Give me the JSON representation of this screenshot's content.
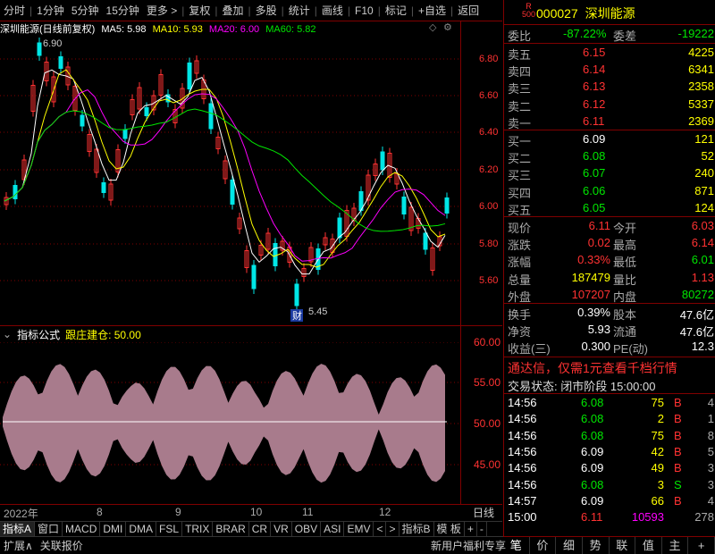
{
  "toolbar": {
    "items": [
      "分时",
      "1分钟",
      "5分钟",
      "15分钟",
      "更多 >",
      "复权",
      "叠加",
      "多股",
      "统计",
      "画线",
      "F10",
      "标记",
      "+自选",
      "返回"
    ]
  },
  "chart_head": {
    "title": "深圳能源(日线前复权)",
    "ma5": "MA5: 5.98",
    "ma10": "MA10: 5.93",
    "ma20": "MA20: 6.00",
    "ma60": "MA60: 5.82"
  },
  "price_axis": [
    "6.80",
    "6.60",
    "6.40",
    "6.20",
    "6.00",
    "5.80",
    "5.60"
  ],
  "annotations": {
    "high": "6.90",
    "low": "5.45",
    "low_tag": "财"
  },
  "indicator": {
    "label": "指标公式",
    "name": "跟庄建仓: 50.00",
    "axis": [
      "60.00",
      "55.00",
      "50.00",
      "45.00"
    ]
  },
  "dates": [
    "2022年",
    "8",
    "9",
    "10",
    "11",
    "12"
  ],
  "day_button": "日线",
  "tabs": [
    "指标A",
    "窗口",
    "MACD",
    "DMI",
    "DMA",
    "FSL",
    "TRIX",
    "BRAR",
    "CR",
    "VR",
    "OBV",
    "ASI",
    "EMV",
    "<",
    ">",
    "指标B",
    "模 板",
    "+",
    "-"
  ],
  "status": {
    "left1": "扩展∧",
    "left2": "关联报价",
    "right": "新用户福利专享"
  },
  "quote": {
    "badge_top": "R",
    "badge_bot": "500",
    "code": "000027",
    "name": "深圳能源",
    "weibi_label": "委比",
    "weibi": "-87.22%",
    "weicha_label": "委差",
    "weicha": "-19222",
    "sells": [
      {
        "label": "卖五",
        "price": "6.15",
        "vol": "4225"
      },
      {
        "label": "卖四",
        "price": "6.14",
        "vol": "6341"
      },
      {
        "label": "卖三",
        "price": "6.13",
        "vol": "2358"
      },
      {
        "label": "卖二",
        "price": "6.12",
        "vol": "5337"
      },
      {
        "label": "卖一",
        "price": "6.11",
        "vol": "2369"
      }
    ],
    "buys": [
      {
        "label": "买一",
        "price": "6.09",
        "vol": "121"
      },
      {
        "label": "买二",
        "price": "6.08",
        "vol": "52"
      },
      {
        "label": "买三",
        "price": "6.07",
        "vol": "240"
      },
      {
        "label": "买四",
        "price": "6.06",
        "vol": "871"
      },
      {
        "label": "买五",
        "price": "6.05",
        "vol": "124"
      }
    ],
    "stats": [
      {
        "l1": "现价",
        "v1": "6.11",
        "l2": "今开",
        "v2": "6.03"
      },
      {
        "l1": "涨跌",
        "v1": "0.02",
        "l2": "最高",
        "v2": "6.14"
      },
      {
        "l1": "涨幅",
        "v1": "0.33%",
        "l2": "最低",
        "v2": "6.01"
      },
      {
        "l1": "总量",
        "v1": "187479",
        "l2": "量比",
        "v2": "1.13"
      },
      {
        "l1": "外盘",
        "v1": "107207",
        "l2": "内盘",
        "v2": "80272"
      }
    ],
    "stats2": [
      {
        "l1": "换手",
        "v1": "0.39%",
        "l2": "股本",
        "v2": "47.6亿"
      },
      {
        "l1": "净资",
        "v1": "5.93",
        "l2": "流通",
        "v2": "47.6亿"
      },
      {
        "l1": "收益(三)",
        "v1": "0.300",
        "l2": "PE(动)",
        "v2": "12.3"
      }
    ],
    "promo": "通达信，仅需1元查看千档行情",
    "trade_state": "交易状态: 闭市阶段  15:00:00",
    "ticks": [
      {
        "t": "14:56",
        "p": "6.08",
        "v": "75",
        "bs": "B",
        "n": "4"
      },
      {
        "t": "14:56",
        "p": "6.08",
        "v": "2",
        "bs": "B",
        "n": "1"
      },
      {
        "t": "14:56",
        "p": "6.08",
        "v": "75",
        "bs": "B",
        "n": "8"
      },
      {
        "t": "14:56",
        "p": "6.09",
        "v": "42",
        "bs": "B",
        "n": "5"
      },
      {
        "t": "14:56",
        "p": "6.09",
        "v": "49",
        "bs": "B",
        "n": "3"
      },
      {
        "t": "14:56",
        "p": "6.08",
        "v": "3",
        "bs": "S",
        "n": "3"
      },
      {
        "t": "14:57",
        "p": "6.09",
        "v": "66",
        "bs": "B",
        "n": "4"
      },
      {
        "t": "15:00",
        "p": "6.11",
        "v": "10593",
        "bs": "",
        "n": "278"
      }
    ],
    "bottom_tabs": [
      "笔",
      "价",
      "细",
      "势",
      "联",
      "值",
      "主",
      "+"
    ]
  }
}
